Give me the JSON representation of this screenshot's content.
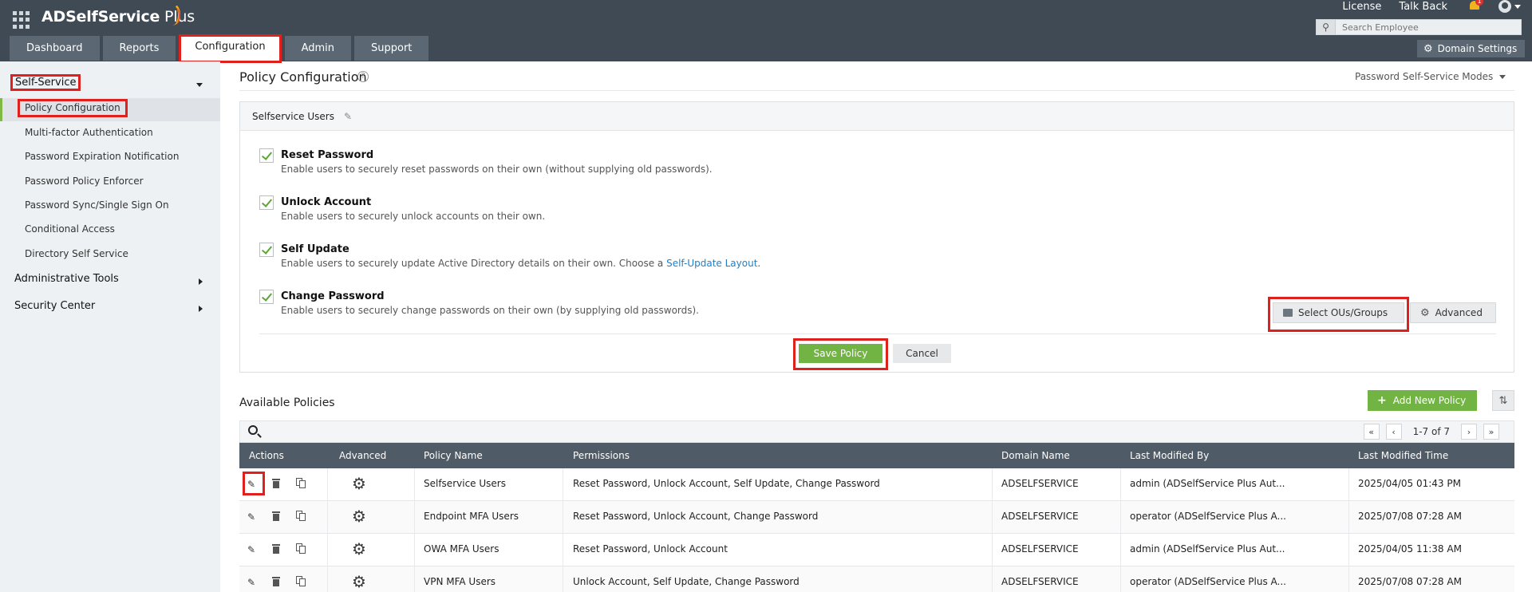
{
  "app": {
    "name_bold": "ADSelfService",
    "name_light": " Plus"
  },
  "header": {
    "links": [
      "License",
      "Talk Back"
    ],
    "notification_count": "1",
    "search_placeholder": "Search Employee",
    "domain_settings": "Domain Settings"
  },
  "tabs": [
    {
      "label": "Dashboard"
    },
    {
      "label": "Reports"
    },
    {
      "label": "Configuration",
      "active": true
    },
    {
      "label": "Admin"
    },
    {
      "label": "Support"
    }
  ],
  "sidebar": {
    "section_self_service": "Self-Service",
    "items": [
      {
        "label": "Policy Configuration",
        "active": true
      },
      {
        "label": "Multi-factor Authentication"
      },
      {
        "label": "Password Expiration Notification"
      },
      {
        "label": "Password Policy Enforcer"
      },
      {
        "label": "Password Sync/Single Sign On"
      },
      {
        "label": "Conditional Access"
      },
      {
        "label": "Directory Self Service"
      }
    ],
    "section_admin_tools": "Administrative Tools",
    "section_security": "Security Center"
  },
  "main": {
    "title": "Policy Configuration",
    "modes_label": "Password Self-Service Modes",
    "policy_name": "Selfservice Users",
    "options": [
      {
        "title": "Reset Password",
        "desc": "Enable users to securely reset passwords on their own (without supplying old passwords).",
        "checked": true
      },
      {
        "title": "Unlock Account",
        "desc": "Enable users to securely unlock accounts on their own.",
        "checked": true
      },
      {
        "title": "Self Update",
        "desc": "Enable users to securely update Active Directory details on their own. Choose a ",
        "link": "Self-Update Layout",
        "desc_end": ".",
        "checked": true
      },
      {
        "title": "Change Password",
        "desc": "Enable users to securely change passwords on their own (by supplying old passwords).",
        "checked": true
      }
    ],
    "select_ous": "Select OUs/Groups",
    "advanced": "Advanced",
    "save": "Save Policy",
    "cancel": "Cancel"
  },
  "policies": {
    "title": "Available Policies",
    "add_button": "Add New Policy",
    "pager_text": "1-7 of 7",
    "columns": [
      "Actions",
      "Advanced",
      "Policy Name",
      "Permissions",
      "Domain Name",
      "Last Modified By",
      "Last Modified Time"
    ],
    "rows": [
      {
        "name": "Selfservice Users",
        "permissions": "Reset Password, Unlock Account, Self Update, Change Password",
        "domain": "ADSELFSERVICE",
        "modified_by": "admin (ADSelfService Plus Aut...",
        "modified_time": "2025/04/05 01:43 PM"
      },
      {
        "name": "Endpoint MFA Users",
        "permissions": "Reset Password, Unlock Account, Change Password",
        "domain": "ADSELFSERVICE",
        "modified_by": "operator (ADSelfService Plus A...",
        "modified_time": "2025/07/08 07:28 AM"
      },
      {
        "name": "OWA MFA Users",
        "permissions": "Reset Password, Unlock Account",
        "domain": "ADSELFSERVICE",
        "modified_by": "admin (ADSelfService Plus Aut...",
        "modified_time": "2025/04/05 11:38 AM"
      },
      {
        "name": "VPN MFA Users",
        "permissions": "Unlock Account, Self Update, Change Password",
        "domain": "ADSELFSERVICE",
        "modified_by": "operator (ADSelfService Plus A...",
        "modified_time": "2025/07/08 07:28 AM"
      }
    ]
  }
}
